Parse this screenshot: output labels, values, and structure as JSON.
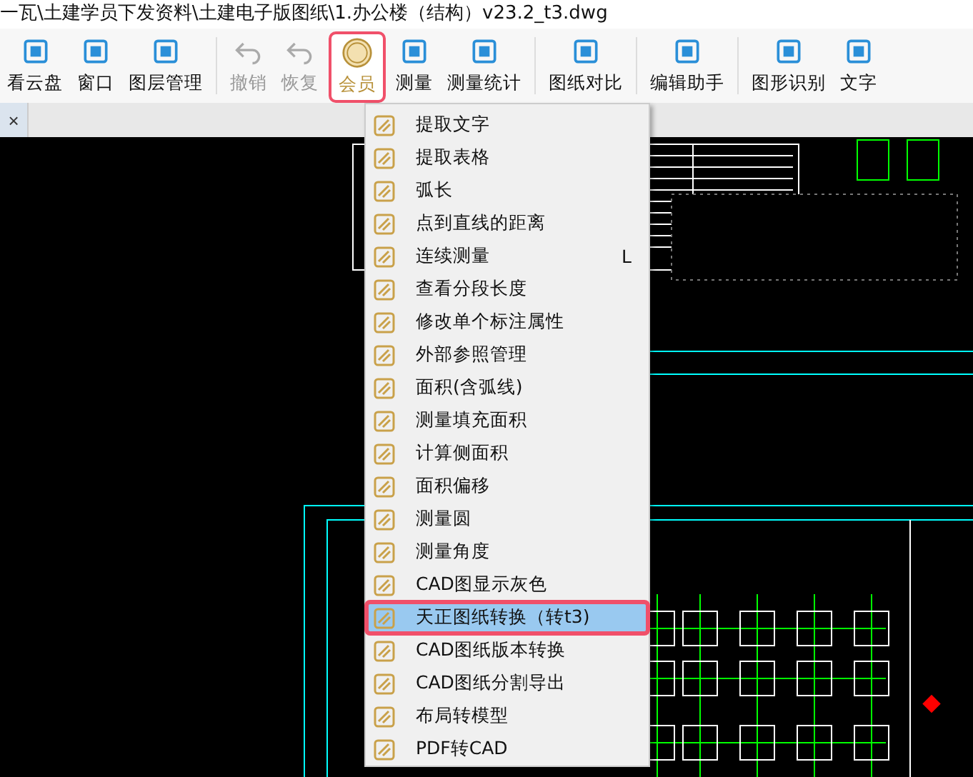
{
  "window": {
    "title": "一瓦\\土建学员下发资料\\土建电子版图纸\\1.办公楼（结构）v23.2_t3.dwg"
  },
  "toolbar": [
    {
      "kind": "button",
      "label": "看云盘",
      "disabled": false,
      "selected": false
    },
    {
      "kind": "button",
      "label": "窗口",
      "disabled": false,
      "selected": false
    },
    {
      "kind": "button",
      "label": "图层管理",
      "disabled": false,
      "selected": false
    },
    {
      "kind": "separator"
    },
    {
      "kind": "button",
      "label": "撤销",
      "disabled": true,
      "selected": false
    },
    {
      "kind": "button",
      "label": "恢复",
      "disabled": true,
      "selected": false
    },
    {
      "kind": "button",
      "label": "会员",
      "disabled": false,
      "selected": true
    },
    {
      "kind": "button",
      "label": "测量",
      "disabled": false,
      "selected": false
    },
    {
      "kind": "button",
      "label": "测量统计",
      "disabled": false,
      "selected": false
    },
    {
      "kind": "separator"
    },
    {
      "kind": "button",
      "label": "图纸对比",
      "disabled": false,
      "selected": false
    },
    {
      "kind": "separator"
    },
    {
      "kind": "button",
      "label": "编辑助手",
      "disabled": false,
      "selected": false
    },
    {
      "kind": "separator"
    },
    {
      "kind": "button",
      "label": "图形识别",
      "disabled": false,
      "selected": false
    },
    {
      "kind": "button",
      "label": "文字",
      "disabled": false,
      "selected": false
    }
  ],
  "tab_strip": {
    "close": "×"
  },
  "menu": [
    {
      "label": "提取文字",
      "selected": false
    },
    {
      "label": "提取表格",
      "selected": false
    },
    {
      "label": "弧长",
      "selected": false
    },
    {
      "label": "点到直线的距离",
      "selected": false
    },
    {
      "label": "连续测量",
      "shortcut": "L",
      "selected": false
    },
    {
      "label": "查看分段长度",
      "selected": false
    },
    {
      "label": "修改单个标注属性",
      "selected": false
    },
    {
      "label": "外部参照管理",
      "selected": false
    },
    {
      "label": "面积(含弧线)",
      "selected": false
    },
    {
      "label": "测量填充面积",
      "selected": false
    },
    {
      "label": "计算侧面积",
      "selected": false
    },
    {
      "label": "面积偏移",
      "selected": false
    },
    {
      "label": "测量圆",
      "selected": false
    },
    {
      "label": "测量角度",
      "selected": false
    },
    {
      "label": "CAD图显示灰色",
      "selected": false
    },
    {
      "label": "天正图纸转换（转t3)",
      "selected": true
    },
    {
      "label": "CAD图纸版本转换",
      "selected": false
    },
    {
      "label": "CAD图纸分割导出",
      "selected": false
    },
    {
      "label": "布局转模型",
      "selected": false
    },
    {
      "label": "PDF转CAD",
      "selected": false
    }
  ]
}
